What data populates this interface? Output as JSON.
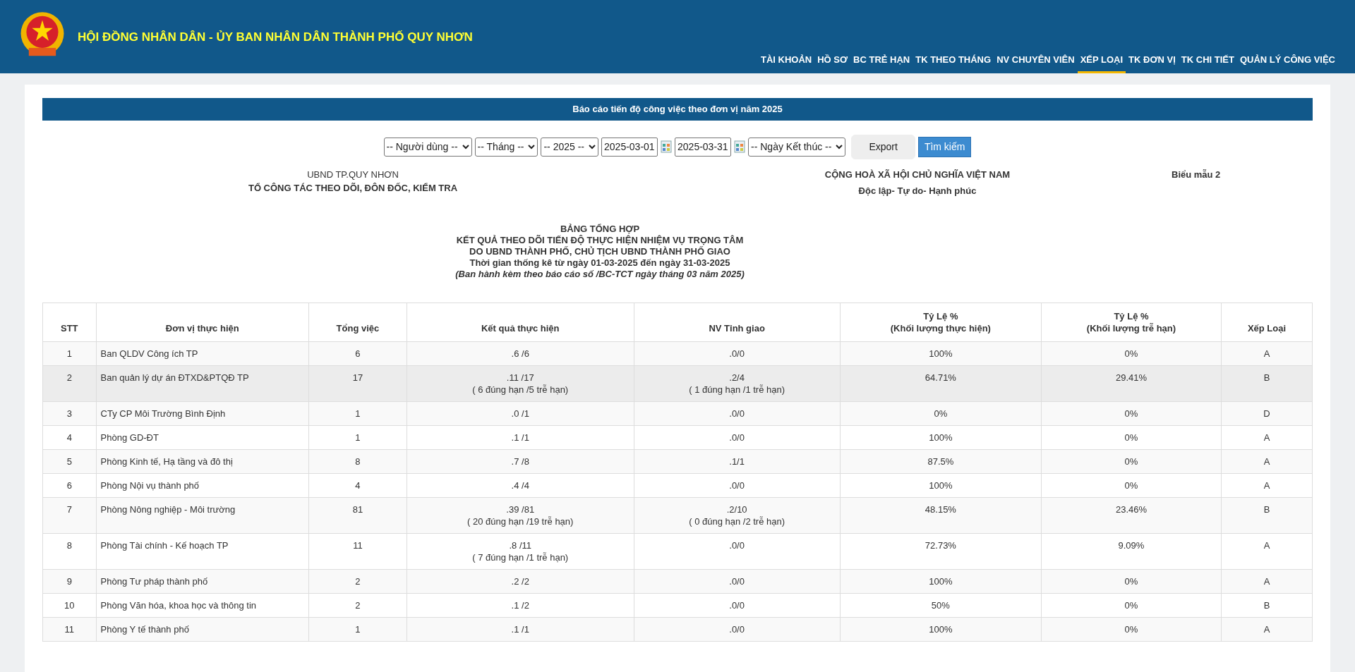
{
  "header": {
    "title": "HỘI ĐỒNG NHÂN DÂN - ỦY BAN NHÂN DÂN THÀNH PHỐ QUY NHƠN"
  },
  "nav": [
    {
      "label": "TÀI KHOẢN",
      "selected": false
    },
    {
      "label": "HỒ SƠ",
      "selected": false
    },
    {
      "label": "BC TRẺ HẠN",
      "selected": false
    },
    {
      "label": "TK THEO THÁNG",
      "selected": false
    },
    {
      "label": "NV CHUYÊN VIÊN",
      "selected": false
    },
    {
      "label": "XẾP LOẠI",
      "selected": true
    },
    {
      "label": "TK ĐƠN VỊ",
      "selected": false
    },
    {
      "label": "TK CHI TIẾT",
      "selected": false
    },
    {
      "label": "QUẢN LÝ CÔNG VIỆC",
      "selected": false
    }
  ],
  "report_bar": {
    "title": "Báo cáo tiến độ công việc theo đơn vị năm 2025"
  },
  "filters": [
    {
      "kind": "select",
      "value": "-- Người dùng --"
    },
    {
      "kind": "select",
      "value": "-- Tháng --"
    },
    {
      "kind": "select",
      "value": "-- 2025 --"
    },
    {
      "kind": "date",
      "value": "2025-03-01"
    },
    {
      "kind": "date",
      "value": "2025-03-31"
    },
    {
      "kind": "select",
      "value": "-- Ngày Kết thúc --"
    }
  ],
  "buttons": {
    "export": "Export",
    "search": "Tìm kiếm"
  },
  "letterhead": {
    "agency": "UBND TP.QUY NHƠN",
    "team": "TỔ CÔNG TÁC THEO DÕI, ĐÔN ĐỐC, KIỂM TRA",
    "nation": "CỘNG HOÀ XÃ HỘI CHỦ NGHĨA VIỆT NAM",
    "motto": "Độc lập- Tự do- Hạnh phúc",
    "form": "Biểu mẫu 2"
  },
  "report_title": [
    "BẢNG TỔNG HỢP",
    "KẾT QUẢ THEO DÕI TIẾN ĐỘ THỰC HIỆN NHIỆM VỤ TRỌNG TÂM",
    "DO UBND THÀNH PHỐ, CHỦ TỊCH UBND THÀNH PHỐ GIAO",
    "Thời gian thống kê từ ngày 01-03-2025 đến ngày 31-03-2025"
  ],
  "report_note": "(Ban hành kèm theo báo cáo số /BC-TCT ngày tháng 03 năm 2025)",
  "table": {
    "columns": [
      "STT",
      "Đơn vị thực hiện",
      "Tổng việc",
      "Kết quả thực hiện",
      "NV Tỉnh giao",
      "Tỷ Lệ %\n(Khối lượng thực hiện)",
      "Tỷ Lệ %\n(Khối lượng trễ hạn)",
      "Xếp Loại"
    ],
    "rows": [
      {
        "hovered": false,
        "cells": [
          [
            "1"
          ],
          [
            "Ban QLDV Công ích TP"
          ],
          [
            "6"
          ],
          [
            ".6 /6"
          ],
          [
            ".0/0"
          ],
          [
            "100%"
          ],
          [
            "0%"
          ],
          [
            "A"
          ]
        ]
      },
      {
        "hovered": true,
        "cells": [
          [
            "2"
          ],
          [
            "Ban quản lý dự án ĐTXD&PTQĐ TP"
          ],
          [
            "17"
          ],
          [
            ".11 /17",
            "( 6 đúng hạn /5 trễ hạn)"
          ],
          [
            ".2/4",
            "( 1 đúng hạn /1 trễ hạn)"
          ],
          [
            "64.71%"
          ],
          [
            "29.41%"
          ],
          [
            "B"
          ]
        ]
      },
      {
        "hovered": false,
        "cells": [
          [
            "3"
          ],
          [
            "CTy CP Môi Trường Bình Định"
          ],
          [
            "1"
          ],
          [
            ".0 /1"
          ],
          [
            ".0/0"
          ],
          [
            "0%"
          ],
          [
            "0%"
          ],
          [
            "D"
          ]
        ]
      },
      {
        "hovered": false,
        "cells": [
          [
            "4"
          ],
          [
            "Phòng GD-ĐT"
          ],
          [
            "1"
          ],
          [
            ".1 /1"
          ],
          [
            ".0/0"
          ],
          [
            "100%"
          ],
          [
            "0%"
          ],
          [
            "A"
          ]
        ]
      },
      {
        "hovered": false,
        "cells": [
          [
            "5"
          ],
          [
            "Phòng Kinh tế, Hạ tầng và đô thị"
          ],
          [
            "8"
          ],
          [
            ".7 /8"
          ],
          [
            ".1/1"
          ],
          [
            "87.5%"
          ],
          [
            "0%"
          ],
          [
            "A"
          ]
        ]
      },
      {
        "hovered": false,
        "cells": [
          [
            "6"
          ],
          [
            "Phòng Nội vụ thành phố"
          ],
          [
            "4"
          ],
          [
            ".4 /4"
          ],
          [
            ".0/0"
          ],
          [
            "100%"
          ],
          [
            "0%"
          ],
          [
            "A"
          ]
        ]
      },
      {
        "hovered": false,
        "cells": [
          [
            "7"
          ],
          [
            "Phòng Nông nghiệp - Môi trường"
          ],
          [
            "81"
          ],
          [
            ".39 /81",
            "( 20 đúng hạn /19 trễ hạn)"
          ],
          [
            ".2/10",
            "( 0 đúng hạn /2 trễ hạn)"
          ],
          [
            "48.15%"
          ],
          [
            "23.46%"
          ],
          [
            "B"
          ]
        ]
      },
      {
        "hovered": false,
        "cells": [
          [
            "8"
          ],
          [
            "Phòng Tài chính - Kế hoạch TP"
          ],
          [
            "11"
          ],
          [
            ".8 /11",
            "( 7 đúng hạn /1 trễ hạn)"
          ],
          [
            ".0/0"
          ],
          [
            "72.73%"
          ],
          [
            "9.09%"
          ],
          [
            "A"
          ]
        ]
      },
      {
        "hovered": false,
        "cells": [
          [
            "9"
          ],
          [
            "Phòng Tư pháp thành phố"
          ],
          [
            "2"
          ],
          [
            ".2 /2"
          ],
          [
            ".0/0"
          ],
          [
            "100%"
          ],
          [
            "0%"
          ],
          [
            "A"
          ]
        ]
      },
      {
        "hovered": false,
        "cells": [
          [
            "10"
          ],
          [
            "Phòng Văn hóa, khoa học và thông tin"
          ],
          [
            "2"
          ],
          [
            ".1 /2"
          ],
          [
            ".0/0"
          ],
          [
            "50%"
          ],
          [
            "0%"
          ],
          [
            "B"
          ]
        ]
      },
      {
        "hovered": false,
        "cells": [
          [
            "11"
          ],
          [
            "Phòng Y tế thành phố"
          ],
          [
            "1"
          ],
          [
            ".1 /1"
          ],
          [
            ".0/0"
          ],
          [
            "100%"
          ],
          [
            "0%"
          ],
          [
            "A"
          ]
        ]
      }
    ]
  }
}
